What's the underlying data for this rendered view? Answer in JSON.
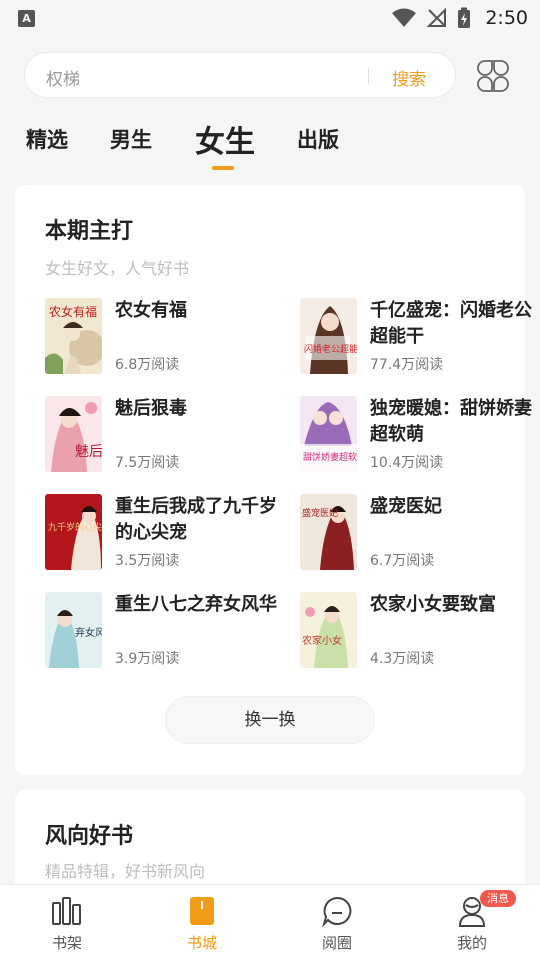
{
  "status_bar": {
    "time": "2:50",
    "left_icon": "A"
  },
  "search": {
    "placeholder": "权梯",
    "button": "搜索"
  },
  "tabs": [
    {
      "label": "精选"
    },
    {
      "label": "男生"
    },
    {
      "label": "女生",
      "active": true
    },
    {
      "label": "出版"
    }
  ],
  "section_main": {
    "title": "本期主打",
    "subtitle": "女生好文，人气好书",
    "books": [
      {
        "title": "农女有福",
        "reads": "6.8万阅读"
      },
      {
        "title": "千亿盛宠：闪婚老公超能干",
        "reads": "77.4万阅读"
      },
      {
        "title": "魅后狠毒",
        "reads": "7.5万阅读"
      },
      {
        "title": "独宠暖媳：甜饼娇妻超软萌",
        "reads": "10.4万阅读"
      },
      {
        "title": "重生后我成了九千岁的心尖宠",
        "reads": "3.5万阅读"
      },
      {
        "title": "盛宠医妃",
        "reads": "6.7万阅读"
      },
      {
        "title": "重生八七之弃女风华",
        "reads": "3.9万阅读"
      },
      {
        "title": "农家小女要致富",
        "reads": "4.3万阅读"
      }
    ],
    "cover_texts": [
      "农女有福",
      "闪婚老公超能干",
      "魅后",
      "甜饼娇妻超软萌",
      "九千岁的心尖宠",
      "盛宠医妃",
      "弃女风华",
      "农家小女"
    ],
    "refresh_label": "换一换"
  },
  "section_second": {
    "title": "风向好书",
    "subtitle": "精品特辑，好书新风向"
  },
  "bottom_nav": {
    "items": [
      {
        "label": "书架",
        "icon": "bookshelf-icon"
      },
      {
        "label": "书城",
        "icon": "bookstore-icon",
        "active": true
      },
      {
        "label": "阅圈",
        "icon": "chat-icon"
      },
      {
        "label": "我的",
        "icon": "profile-icon"
      }
    ],
    "badge": "消息"
  },
  "colors": {
    "accent": "#f29b17",
    "badge": "#f4574b"
  }
}
